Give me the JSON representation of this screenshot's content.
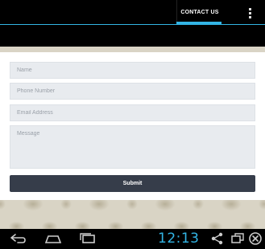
{
  "actionbar": {
    "tab_label": "CONTACT US",
    "accent_color": "#33b5e5",
    "overflow_icon": "overflow-menu-icon"
  },
  "form": {
    "name_placeholder": "Name",
    "phone_placeholder": "Phone Number",
    "email_placeholder": "Email Address",
    "message_placeholder": "Message",
    "submit_label": "Submit",
    "submit_color": "#363d4a",
    "field_color": "#e8ebef"
  },
  "navbar": {
    "clock": "12:13",
    "clock_color": "#33b5e5",
    "icons": [
      "back-icon",
      "home-icon",
      "recent-apps-icon",
      "share-icon",
      "window-icon",
      "close-icon"
    ]
  }
}
